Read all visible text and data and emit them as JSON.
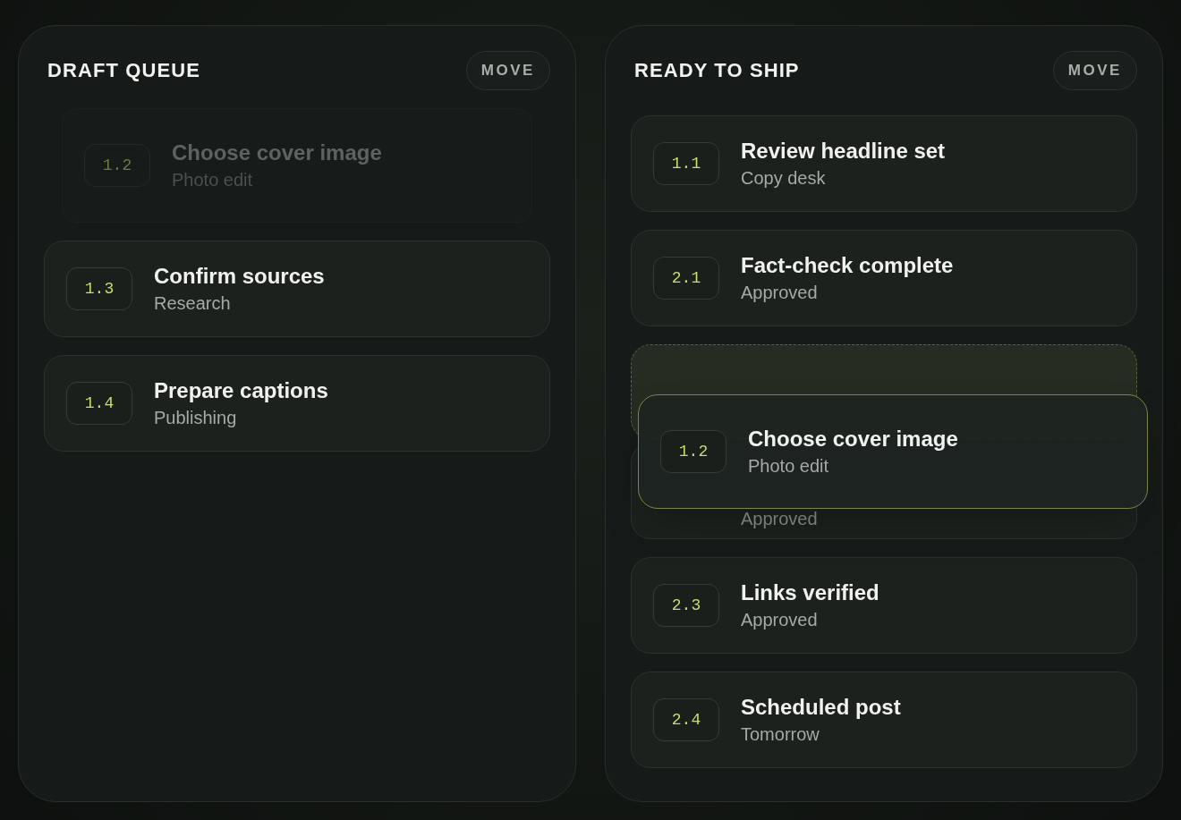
{
  "columns": [
    {
      "title": "DRAFT QUEUE",
      "button": "MOVE",
      "cards": [
        {
          "kind": "ghost",
          "number": "1.2",
          "title": "Choose cover image",
          "subtitle": "Photo edit"
        },
        {
          "kind": "card",
          "number": "1.3",
          "title": "Confirm sources",
          "subtitle": "Research"
        },
        {
          "kind": "card",
          "number": "1.4",
          "title": "Prepare captions",
          "subtitle": "Publishing"
        }
      ]
    },
    {
      "title": "READY TO SHIP",
      "button": "MOVE",
      "cards": [
        {
          "kind": "card",
          "number": "1.1",
          "title": "Review headline set",
          "subtitle": "Copy desk"
        },
        {
          "kind": "card",
          "number": "2.1",
          "title": "Fact-check complete",
          "subtitle": "Approved"
        },
        {
          "kind": "placeholder"
        },
        {
          "kind": "covered",
          "subtitle": "Approved"
        },
        {
          "kind": "card",
          "number": "2.3",
          "title": "Links verified",
          "subtitle": "Approved"
        },
        {
          "kind": "card",
          "number": "2.4",
          "title": "Scheduled post",
          "subtitle": "Tomorrow"
        }
      ],
      "dragged_card": {
        "number": "1.2",
        "title": "Choose cover image",
        "subtitle": "Photo edit"
      }
    }
  ]
}
